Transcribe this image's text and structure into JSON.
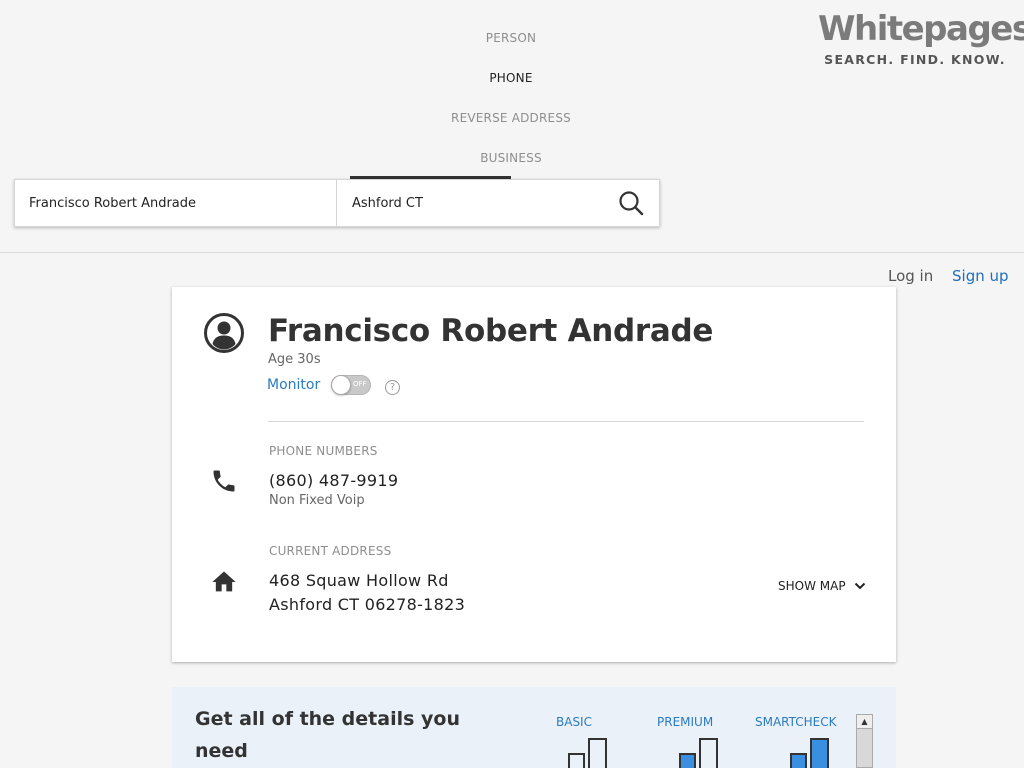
{
  "nav": {
    "tabs": [
      {
        "label": "PERSON",
        "active": false
      },
      {
        "label": "PHONE",
        "active": true
      },
      {
        "label": "REVERSE ADDRESS",
        "active": false
      },
      {
        "label": "BUSINESS",
        "active": false
      }
    ]
  },
  "logo": {
    "word": "Whitepages",
    "tagline": "SEARCH. FIND. KNOW."
  },
  "search": {
    "name_value": "Francisco Robert Andrade",
    "location_value": "Ashford CT"
  },
  "auth": {
    "login": "Log in",
    "signup": "Sign up"
  },
  "result": {
    "name": "Francisco Robert Andrade",
    "age": "Age 30s",
    "monitor_label": "Monitor",
    "toggle_text": "OFF",
    "help": "?",
    "phone_section_label": "PHONE NUMBERS",
    "phone_number": "(860) 487-9919",
    "phone_type": "Non Fixed Voip",
    "address_section_label": "CURRENT ADDRESS",
    "address_line1": "468 Squaw Hollow Rd",
    "address_line2": "Ashford CT 06278-1823",
    "show_map": "SHOW MAP"
  },
  "promo": {
    "title": "Get all of the details you need",
    "plans": [
      "BASIC",
      "PREMIUM",
      "SMARTCHECK"
    ]
  },
  "colors": {
    "accent": "#2a7bc1",
    "bar_fill": "#3b8fe0",
    "background": "#f5f5f5"
  },
  "icons": [
    "search-icon",
    "avatar-icon",
    "phone-icon",
    "home-icon",
    "chevron-down-icon",
    "help-icon"
  ]
}
